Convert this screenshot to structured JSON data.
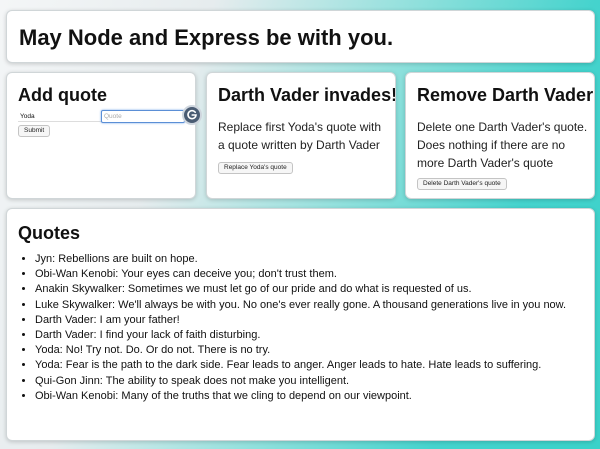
{
  "header": {
    "title": "May Node and Express be with you."
  },
  "add_quote": {
    "title": "Add quote",
    "name_value": "Yoda",
    "quote_placeholder": "Quote",
    "submit_label": "Submit"
  },
  "vader_invades": {
    "title": "Darth Vader invades!",
    "description": "Replace first Yoda's quote with a quote written by Darth Vader",
    "button_label": "Replace Yoda's quote"
  },
  "remove_vader": {
    "title": "Remove Darth Vader!",
    "description": "Delete one Darth Vader's quote. Does nothing if there are no more Darth Vader's quote",
    "button_label": "Delete Darth Vader's quote"
  },
  "quotes": {
    "title": "Quotes",
    "items": [
      "Jyn: Rebellions are built on hope.",
      "Obi-Wan Kenobi: Your eyes can deceive you; don't trust them.",
      "Anakin Skywalker: Sometimes we must let go of our pride and do what is requested of us.",
      "Luke Skywalker: We'll always be with you. No one's ever really gone. A thousand generations live in you now.",
      "Darth Vader: I am your father!",
      "Darth Vader: I find your lack of faith disturbing.",
      "Yoda: No! Try not. Do. Or do not. There is no try.",
      "Yoda: Fear is the path to the dark side. Fear leads to anger. Anger leads to hate. Hate leads to suffering.",
      "Qui-Gon Jinn: The ability to speak does not make you intelligent.",
      "Obi-Wan Kenobi: Many of the truths that we cling to depend on our viewpoint."
    ]
  },
  "icons": {
    "grammarly": "grammarly-badge-icon"
  },
  "colors": {
    "accent": "#3ad2c9",
    "card_bg": "#ffffff",
    "focus_ring": "#5b8fd6"
  }
}
